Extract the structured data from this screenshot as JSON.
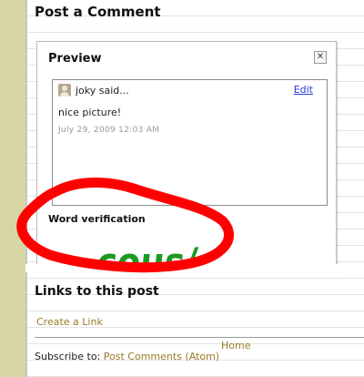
{
  "post_comment": {
    "heading": "Post a Comment"
  },
  "preview": {
    "title": "Preview",
    "close_symbol": "✕",
    "comment": {
      "author": "joky said...",
      "edit_label": "Edit",
      "text": "nice picture!",
      "timestamp": "July 29, 2009 12:03 AM",
      "avatar_icon": "user-avatar-icon"
    },
    "word_verification": {
      "label": "Word verification",
      "captcha_text": "cous/",
      "captcha_color": "#1e9a22"
    }
  },
  "links": {
    "heading": "Links to this post",
    "create_link_label": "Create a Link"
  },
  "footer": {
    "home_label": "Home",
    "subscribe_prefix": "Subscribe to:",
    "subscribe_link_label": "Post Comments (Atom)"
  },
  "colors": {
    "sidebar_strip": "#d7d7a5",
    "link_gold": "#9b7b29",
    "link_blue": "#2a3cd0",
    "annotation_red": "#ff0000"
  }
}
